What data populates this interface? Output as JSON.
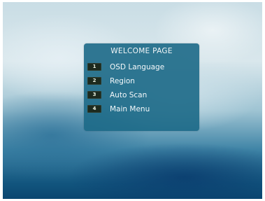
{
  "dialog": {
    "title": "WELCOME PAGE",
    "items": [
      {
        "number": "1",
        "label": "OSD Language"
      },
      {
        "number": "2",
        "label": "Region"
      },
      {
        "number": "3",
        "label": "Auto Scan"
      },
      {
        "number": "4",
        "label": "Main Menu"
      }
    ]
  },
  "colors": {
    "dialog_background": "#1c6987",
    "badge_background": "#1d2a1e",
    "text": "#f4f8fa"
  }
}
